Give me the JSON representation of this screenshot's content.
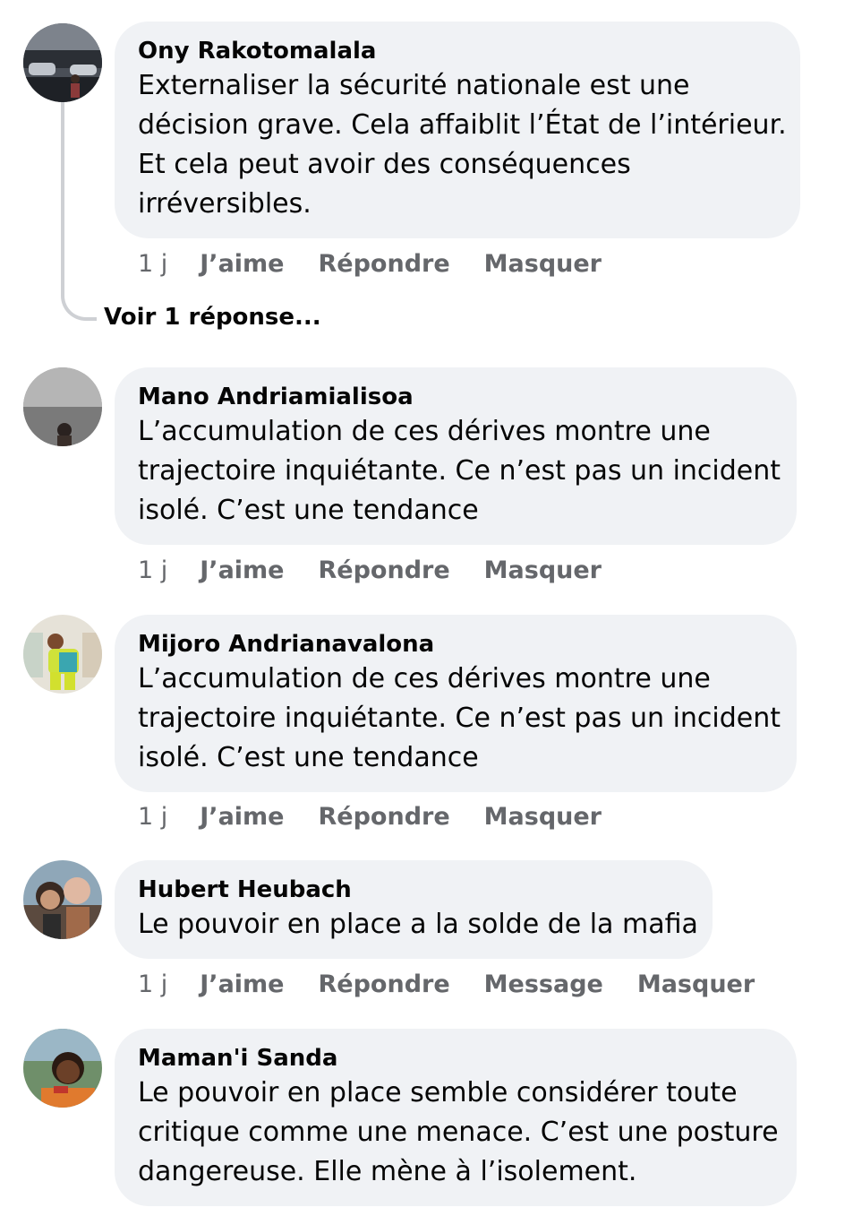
{
  "comments": [
    {
      "author": "Ony Rakotomalala",
      "lines": [
        "Externaliser la sécurité nationale est une",
        "décision grave. Cela affaiblit l’État de l’intérieur.",
        "Et cela peut avoir des conséquences",
        "irréversibles."
      ],
      "time": "1 j",
      "like": "J’aime",
      "reply": "Répondre",
      "hide": "Masquer",
      "view_replies": "Voir 1 réponse..."
    },
    {
      "author": "Mano Andriamialisoa",
      "lines": [
        "L’accumulation de ces dérives montre une",
        "trajectoire inquiétante. Ce n’est pas un incident",
        "isolé. C’est une tendance"
      ],
      "time": "1 j",
      "like": "J’aime",
      "reply": "Répondre",
      "hide": "Masquer"
    },
    {
      "author": "Mijoro Andrianavalona",
      "lines": [
        "L’accumulation de ces dérives montre une",
        "trajectoire inquiétante. Ce n’est pas un incident",
        "isolé. C’est une tendance"
      ],
      "time": "1 j",
      "like": "J’aime",
      "reply": "Répondre",
      "hide": "Masquer"
    },
    {
      "author": "Hubert Heubach",
      "lines": [
        "Le pouvoir en place a la solde de la mafia"
      ],
      "time": "1 j",
      "like": "J’aime",
      "reply": "Répondre",
      "message": "Message",
      "hide": "Masquer"
    },
    {
      "author": "Maman'i Sanda",
      "lines": [
        "Le pouvoir en place semble considérer toute",
        "critique comme une menace. C’est une posture",
        "dangereuse. Elle mène à l’isolement."
      ]
    }
  ],
  "colors": {
    "bubble": "#f0f2f5",
    "text": "#050505",
    "meta": "#65676b",
    "thread_line": "#ced0d4"
  },
  "icons": [
    "avatar-photo"
  ]
}
